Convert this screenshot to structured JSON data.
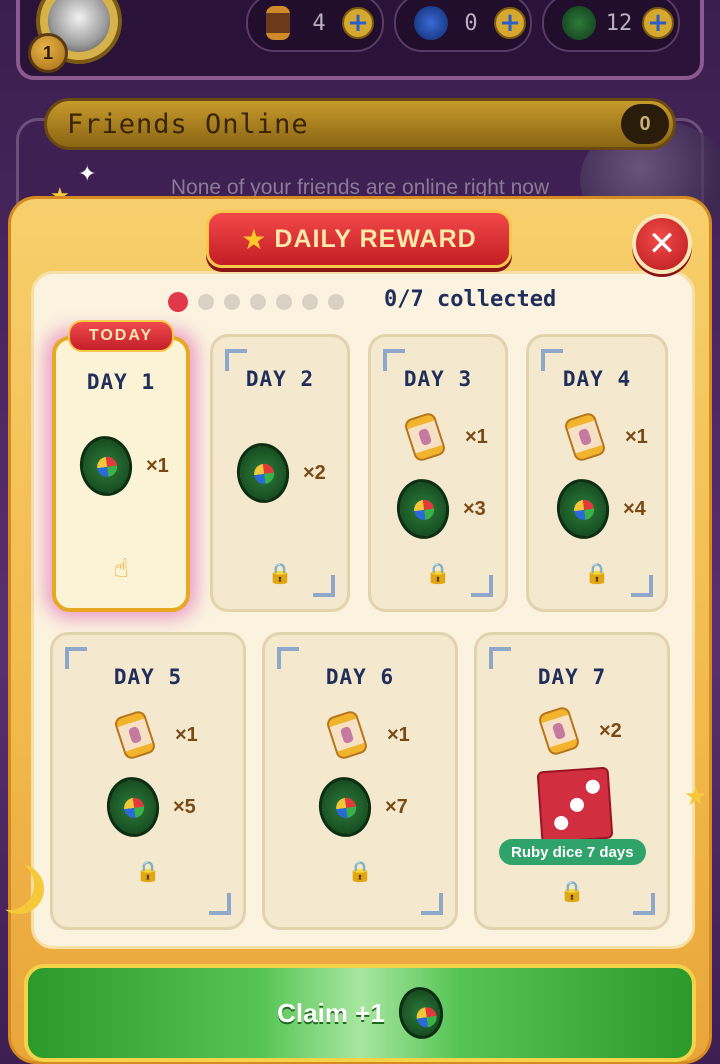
{
  "hud": {
    "level": "1",
    "currencies": [
      {
        "icon": "hourglass-icon",
        "value": "4"
      },
      {
        "icon": "blue-gem-icon",
        "value": "0"
      },
      {
        "icon": "green-token-icon",
        "value": "12"
      }
    ]
  },
  "friends": {
    "title": "Friends Online",
    "count": "0",
    "empty_message": "None of your friends are online right now"
  },
  "modal": {
    "title": "DAILY REWARD",
    "progress_text": "0/7 collected",
    "streak_total": 7,
    "streak_collected": 0,
    "today_tag": "TODAY",
    "days": [
      {
        "label": "DAY 1",
        "rewards": [
          {
            "item": "green-token-icon",
            "qty": "×1"
          }
        ],
        "state": "today"
      },
      {
        "label": "DAY 2",
        "rewards": [
          {
            "item": "green-token-icon",
            "qty": "×2"
          }
        ],
        "state": "locked"
      },
      {
        "label": "DAY 3",
        "rewards": [
          {
            "item": "hourglass-icon",
            "qty": "×1"
          },
          {
            "item": "green-token-icon",
            "qty": "×3"
          }
        ],
        "state": "locked"
      },
      {
        "label": "DAY 4",
        "rewards": [
          {
            "item": "hourglass-icon",
            "qty": "×1"
          },
          {
            "item": "green-token-icon",
            "qty": "×4"
          }
        ],
        "state": "locked"
      },
      {
        "label": "DAY 5",
        "rewards": [
          {
            "item": "hourglass-icon",
            "qty": "×1"
          },
          {
            "item": "green-token-icon",
            "qty": "×5"
          }
        ],
        "state": "locked"
      },
      {
        "label": "DAY 6",
        "rewards": [
          {
            "item": "hourglass-icon",
            "qty": "×1"
          },
          {
            "item": "green-token-icon",
            "qty": "×7"
          }
        ],
        "state": "locked"
      },
      {
        "label": "DAY 7",
        "rewards": [
          {
            "item": "hourglass-icon",
            "qty": "×2"
          }
        ],
        "bonus": "Ruby dice 7 days",
        "state": "locked"
      }
    ],
    "claim": {
      "label": "Claim  +1",
      "icon": "green-token-icon"
    }
  },
  "colors": {
    "accent_red": "#c31e24",
    "gold": "#f2b94a",
    "navy_text": "#1f2e5a",
    "claim_green": "#2b9a2a",
    "bonus_green": "#2fa36a"
  }
}
